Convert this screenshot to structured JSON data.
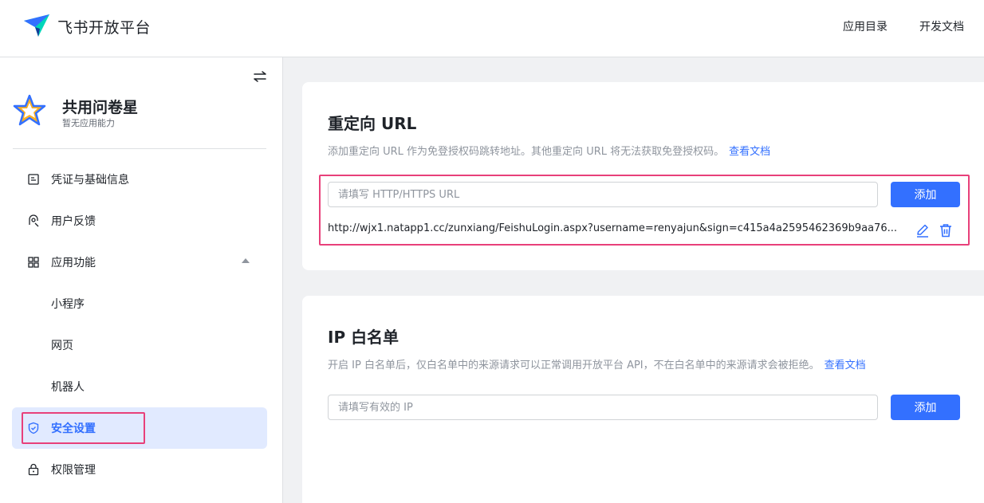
{
  "header": {
    "brand": "飞书开放平台",
    "nav": {
      "catalog": "应用目录",
      "docs": "开发文档"
    },
    "logo_icon": "feishu-paper-plane-icon"
  },
  "sidebar": {
    "app": {
      "name": "共用问卷星",
      "subtitle": "暂无应用能力",
      "icon": "star-icon"
    },
    "items": [
      {
        "label": "凭证与基础信息",
        "icon": "credential-icon"
      },
      {
        "label": "用户反馈",
        "icon": "feedback-icon"
      },
      {
        "label": "应用功能",
        "icon": "grid-icon",
        "expanded": true
      },
      {
        "label": "小程序"
      },
      {
        "label": "网页"
      },
      {
        "label": "机器人"
      },
      {
        "label": "安全设置",
        "icon": "shield-icon",
        "active": true
      },
      {
        "label": "权限管理",
        "icon": "lock-icon"
      }
    ]
  },
  "redirect": {
    "title": "重定向 URL",
    "description": "添加重定向 URL 作为免登授权码跳转地址。其他重定向 URL 将无法获取免登授权码。",
    "doc_link": "查看文档",
    "input_placeholder": "请填写 HTTP/HTTPS URL",
    "add_label": "添加",
    "url": "http://wjx1.natapp1.cc/zunxiang/FeishuLogin.aspx?username=renyajun&sign=c415a4a2595462369b9aa76..."
  },
  "ip_whitelist": {
    "title": "IP 白名单",
    "description": "开启 IP 白名单后，仅白名单中的来源请求可以正常调用开放平台 API，不在白名单中的来源请求会被拒绝。",
    "doc_link": "查看文档",
    "input_placeholder": "请填写有效的 IP",
    "add_label": "添加"
  },
  "colors": {
    "accent": "#3370ff",
    "highlight": "#e8407a",
    "active_bg": "#e1eaff"
  }
}
